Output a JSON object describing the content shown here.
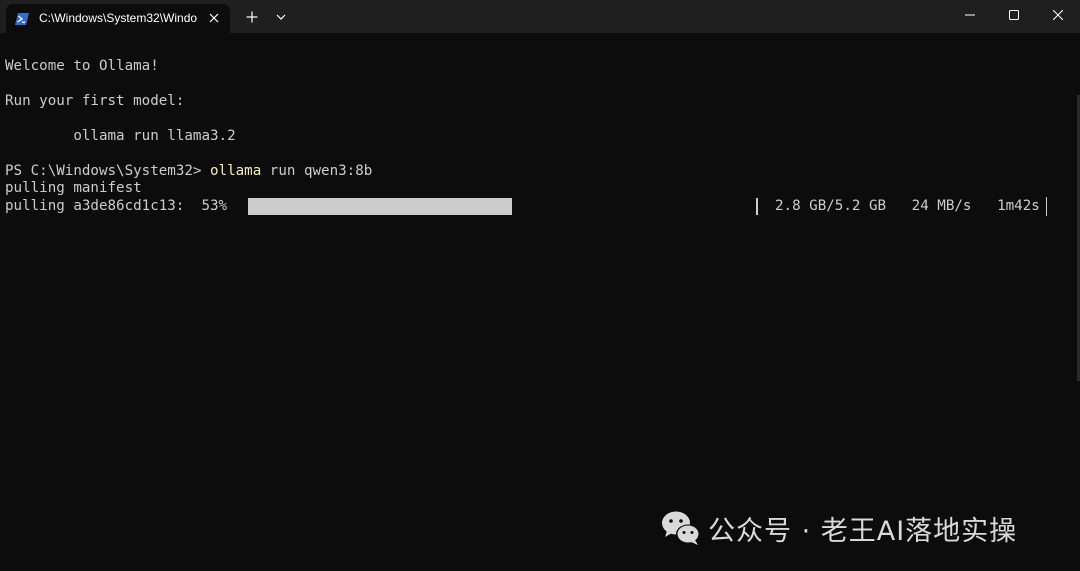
{
  "window": {
    "tab_title": "C:\\Windows\\System32\\Windo",
    "tab_icon": "powershell-icon",
    "new_tab_icon": "plus-icon",
    "dropdown_icon": "chevron-down-icon",
    "controls": [
      "minimize-icon",
      "maximize-icon",
      "close-icon"
    ]
  },
  "terminal": {
    "welcome": "Welcome to Ollama!",
    "run_first": "Run your first model:",
    "example_cmd": "        ollama run llama3.2",
    "prompt": "PS C:\\Windows\\System32> ",
    "command_name": "ollama",
    "command_args": " run qwen3:8b",
    "pulling_manifest": "pulling manifest",
    "pull_line": "pulling a3de86cd1c13:  53%",
    "progress_percent": 53,
    "stats": "2.8 GB/5.2 GB   24 MB/s   1m42s"
  },
  "watermark": {
    "text": "公众号 · 老王AI落地实操",
    "logo": "wechat-icon"
  },
  "colors": {
    "background": "#0c0c0c",
    "titlebar": "#1f1f1f",
    "text": "#cccccc",
    "command_highlight": "#f9f1a5",
    "powershell_blue": "#2b6fd6"
  }
}
